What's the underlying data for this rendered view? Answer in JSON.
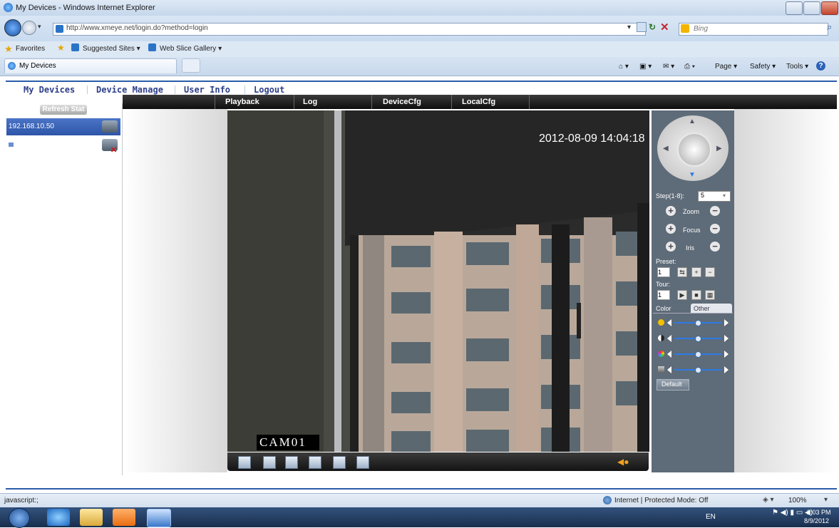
{
  "window": {
    "title": "My Devices - Windows Internet Explorer"
  },
  "browser": {
    "address": "http://www.xmeye.net/login.do?method=login",
    "search_placeholder": "Bing",
    "favorites_label": "Favorites",
    "suggested_sites": "Suggested Sites ▾",
    "web_slice_gallery": "Web Slice Gallery ▾",
    "tab_title": "My Devices",
    "commands": {
      "page": "Page ▾",
      "safety": "Safety ▾",
      "tools": "Tools ▾"
    }
  },
  "page": {
    "nav": {
      "my_devices": "My Devices",
      "device_manage": "Device Manage",
      "user_info": "User Info",
      "logout": "Logout"
    },
    "menu": [
      "Playback",
      "Log",
      "DeviceCfg",
      "LocalCfg"
    ],
    "sidebar": {
      "refresh_label": "Refresh Stat",
      "devices": [
        {
          "label": "192.168.10.50",
          "selected": true
        },
        {
          "label": "",
          "selected": false
        }
      ]
    },
    "video": {
      "timestamp": "2012-08-09 14:04:18",
      "camera_label": "CAM01"
    },
    "ptz": {
      "step_label": "Step(1-8):",
      "step_value": "5",
      "zoom": "Zoom",
      "focus": "Focus",
      "iris": "Iris",
      "preset_label": "Preset:",
      "preset_value": "1",
      "tour_label": "Tour:",
      "tour_value": "1",
      "tab_color": "Color",
      "tab_other": "Other",
      "default_label": "Default",
      "sliders": [
        0.5,
        0.5,
        0.5,
        0.5
      ]
    }
  },
  "statusbar": {
    "left": "javascript:;",
    "zone": "Internet | Protected Mode: Off",
    "zoom": "100%"
  },
  "taskbar": {
    "lang": "EN",
    "time": "2:03 PM",
    "date": "8/9/2012"
  }
}
